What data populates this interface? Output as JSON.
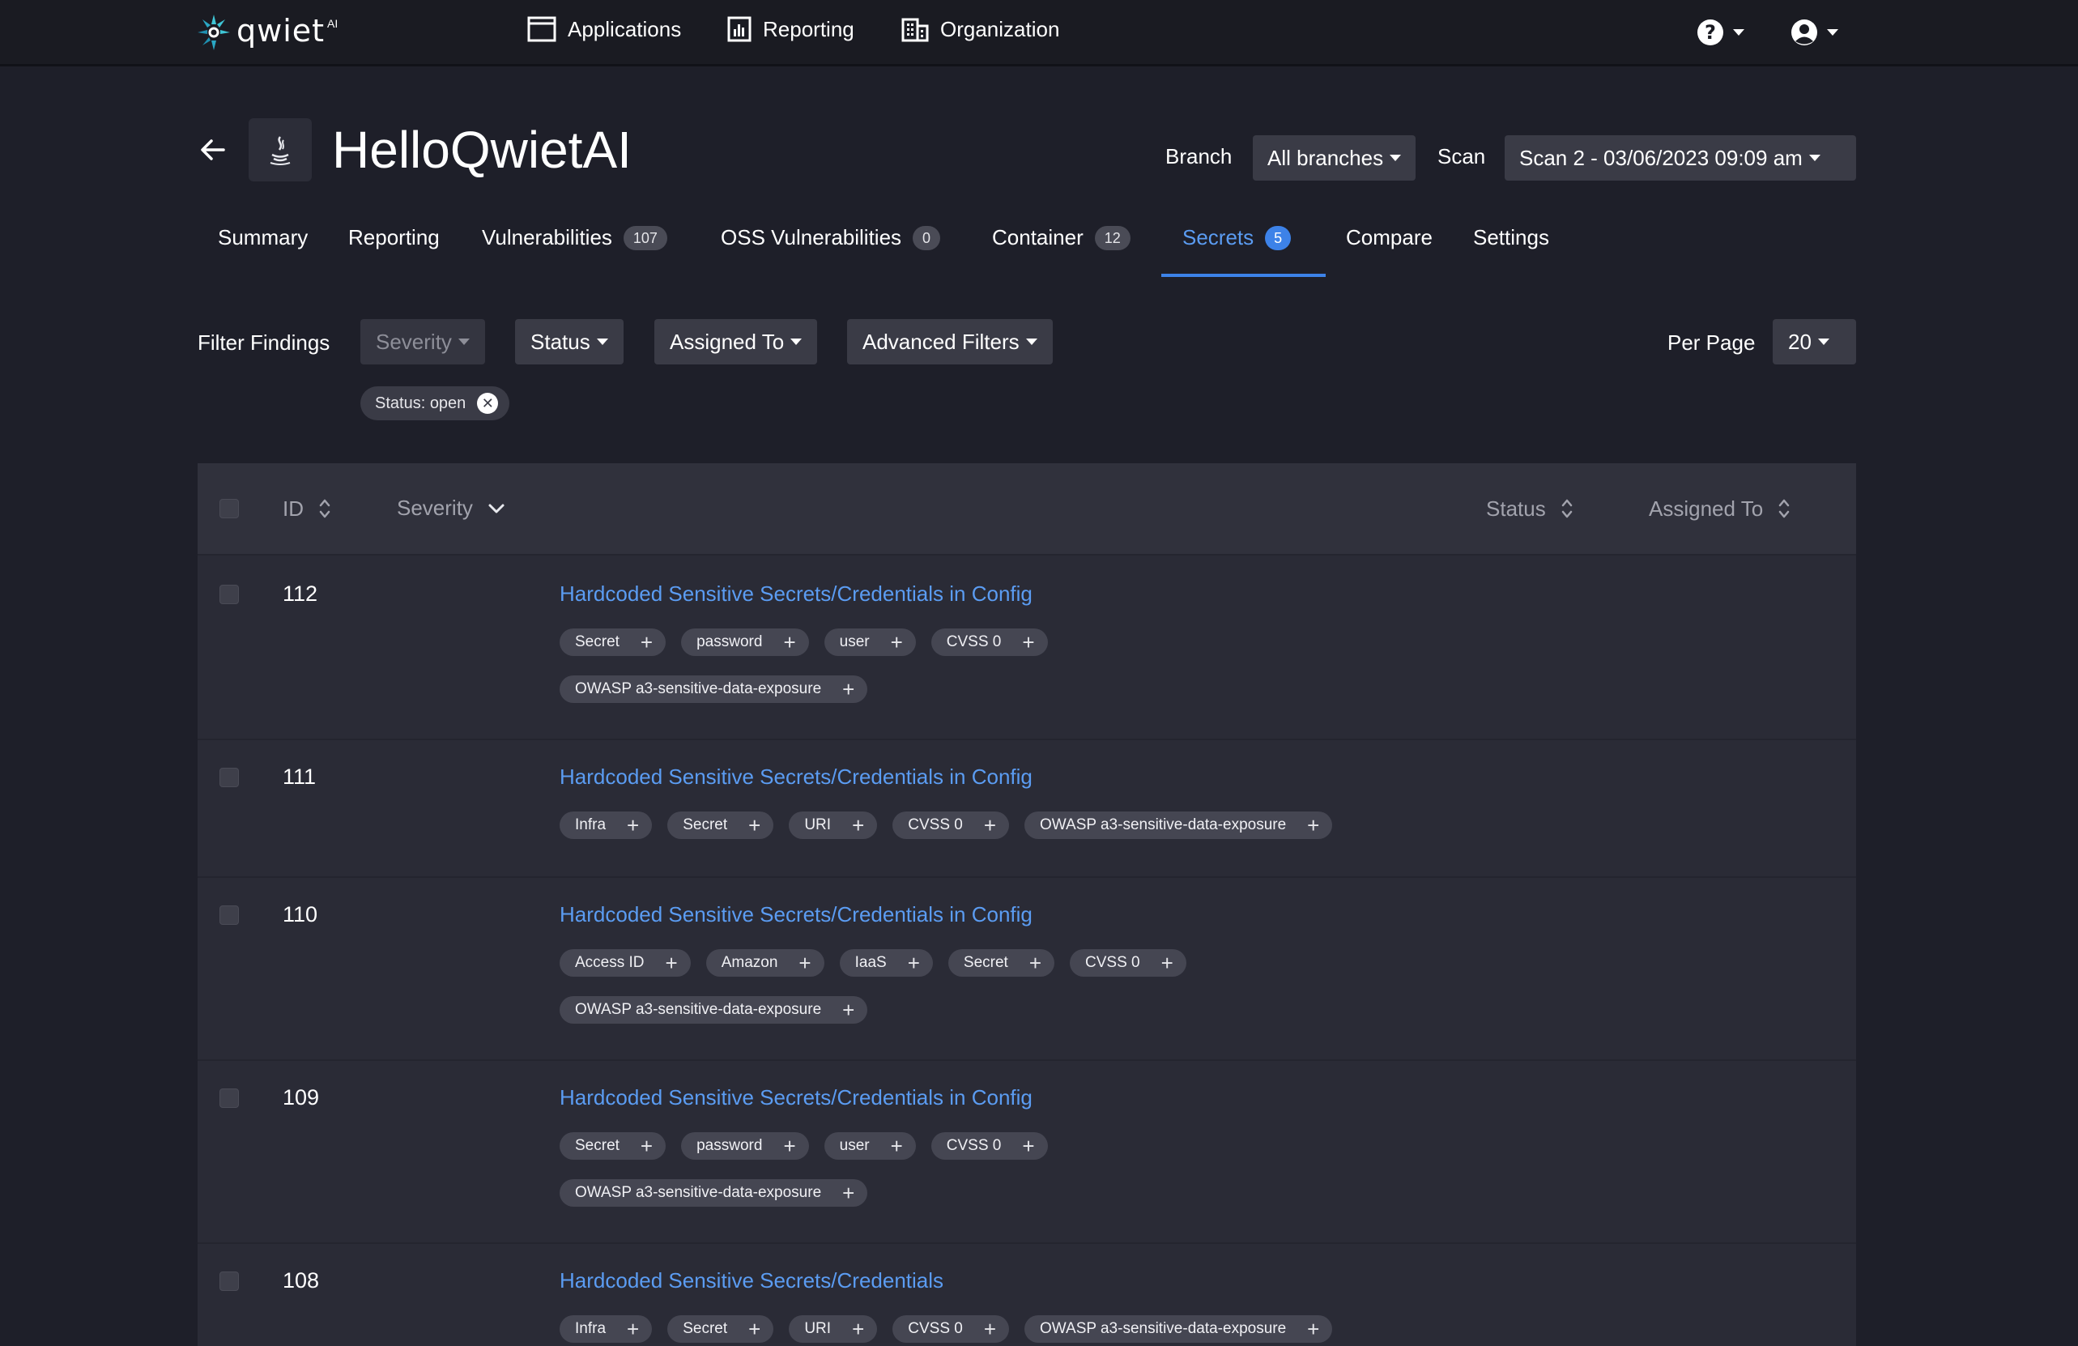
{
  "nav": {
    "logo_text": "qwiet",
    "logo_ai": "AI",
    "items": [
      {
        "label": "Applications",
        "icon": "window-icon"
      },
      {
        "label": "Reporting",
        "icon": "bar-chart-icon"
      },
      {
        "label": "Organization",
        "icon": "building-icon"
      }
    ]
  },
  "header": {
    "title": "HelloQwietAI",
    "branch_label": "Branch",
    "branch_value": "All branches",
    "scan_label": "Scan",
    "scan_value": "Scan 2 - 03/06/2023 09:09 am"
  },
  "tabs": [
    {
      "label": "Summary"
    },
    {
      "label": "Reporting"
    },
    {
      "label": "Vulnerabilities",
      "badge": "107"
    },
    {
      "label": "OSS Vulnerabilities",
      "badge": "0"
    },
    {
      "label": "Container",
      "badge": "12"
    },
    {
      "label": "Secrets",
      "badge": "5",
      "active": true
    },
    {
      "label": "Compare"
    },
    {
      "label": "Settings"
    }
  ],
  "filters": {
    "label": "Filter Findings",
    "severity": "Severity",
    "status": "Status",
    "assigned_to": "Assigned To",
    "advanced": "Advanced Filters",
    "active_chip": "Status: open",
    "per_page_label": "Per Page",
    "per_page_value": "20"
  },
  "table": {
    "headers": {
      "id": "ID",
      "severity": "Severity",
      "status": "Status",
      "assigned_to": "Assigned To"
    },
    "rows": [
      {
        "id": "112",
        "title": "Hardcoded Sensitive Secrets/Credentials in Config",
        "tag_lines": [
          [
            "Secret",
            "password",
            "user",
            "CVSS 0"
          ],
          [
            "OWASP a3-sensitive-data-exposure"
          ]
        ]
      },
      {
        "id": "111",
        "title": "Hardcoded Sensitive Secrets/Credentials in Config",
        "tag_lines": [
          [
            "Infra",
            "Secret",
            "URI",
            "CVSS 0",
            "OWASP a3-sensitive-data-exposure"
          ]
        ]
      },
      {
        "id": "110",
        "title": "Hardcoded Sensitive Secrets/Credentials in Config",
        "tag_lines": [
          [
            "Access ID",
            "Amazon",
            "IaaS",
            "Secret",
            "CVSS 0"
          ],
          [
            "OWASP a3-sensitive-data-exposure"
          ]
        ]
      },
      {
        "id": "109",
        "title": "Hardcoded Sensitive Secrets/Credentials in Config",
        "tag_lines": [
          [
            "Secret",
            "password",
            "user",
            "CVSS 0"
          ],
          [
            "OWASP a3-sensitive-data-exposure"
          ]
        ]
      },
      {
        "id": "108",
        "title": "Hardcoded Sensitive Secrets/Credentials",
        "tag_lines": [
          [
            "Infra",
            "Secret",
            "URI",
            "CVSS 0",
            "OWASP a3-sensitive-data-exposure"
          ]
        ]
      }
    ]
  },
  "colors": {
    "accent": "#3d82e8",
    "link": "#5b9cf2",
    "background": "#1e1f29"
  }
}
